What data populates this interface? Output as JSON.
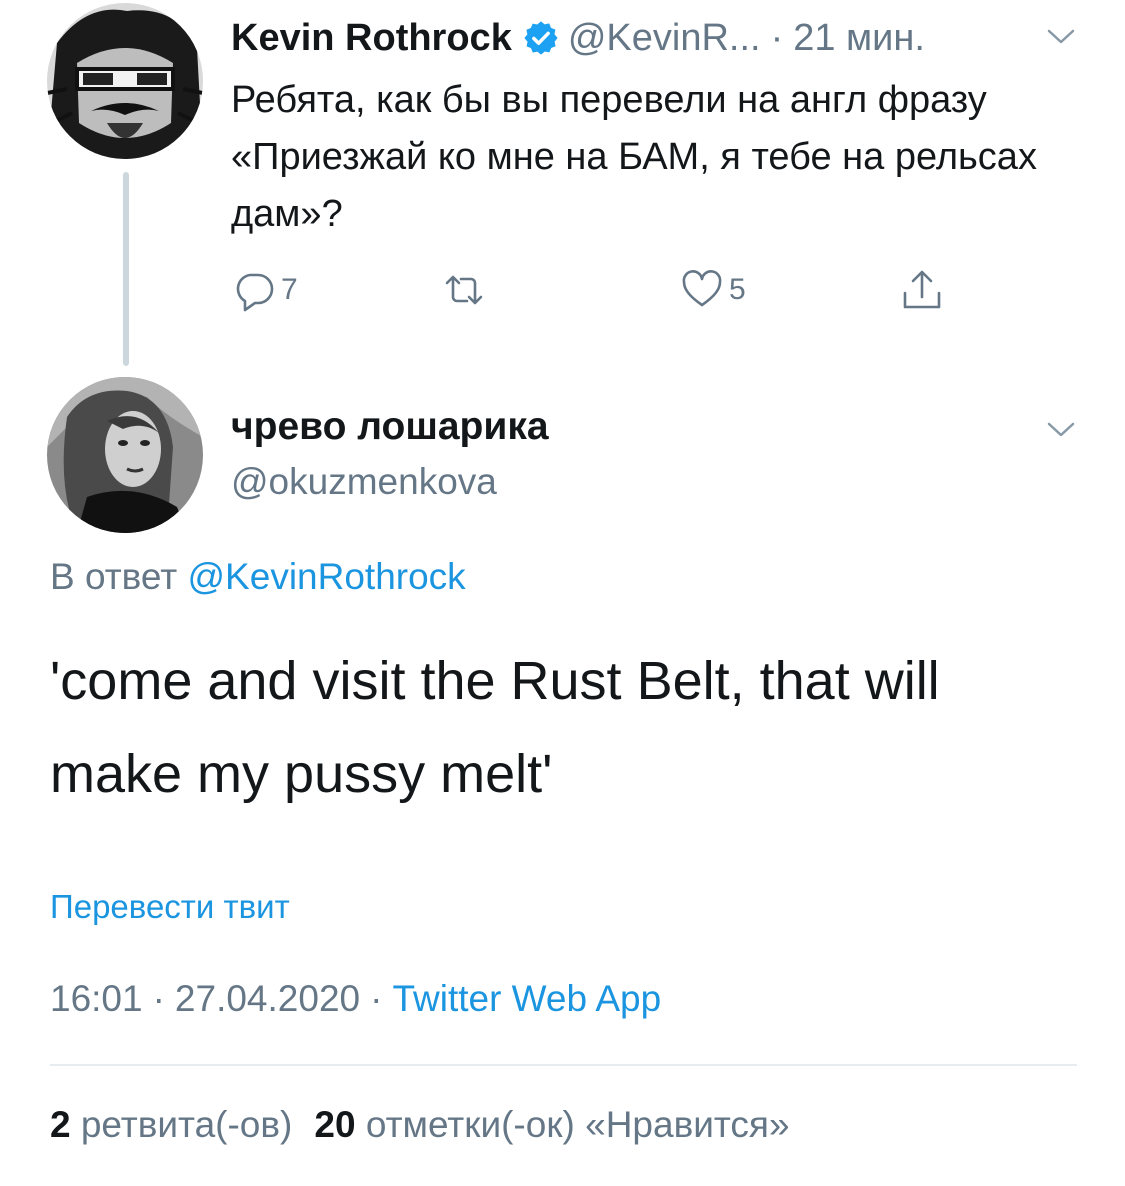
{
  "parent_tweet": {
    "author_name": "Kevin Rothrock",
    "verified_icon": "verified-badge-icon",
    "handle": "@KevinR...",
    "separator": "·",
    "time": "21 мин.",
    "text": "Ребята, как бы вы перевели на англ фразу «Приезжай ко мне на БАМ, я тебе на рельсах дам»?",
    "actions": {
      "reply_count": "7",
      "retweet_count": "",
      "like_count": "5"
    }
  },
  "reply_tweet": {
    "author_name": "чрево лошарика",
    "handle": "@okuzmenkova",
    "reply_to_prefix": "В ответ",
    "reply_to_mention": "@KevinRothrock",
    "text": "'come and visit the Rust Belt, that will make my pussy melt'",
    "translate_label": "Перевести твит",
    "time": "16:01",
    "date": "27.04.2020",
    "separator": "·",
    "source": "Twitter Web App",
    "stats": {
      "retweets_num": "2",
      "retweets_label": "ретвита(-ов)",
      "likes_num": "20",
      "likes_label": "отметки(-ок) «Нравится»"
    }
  },
  "colors": {
    "text_primary": "#14171a",
    "text_secondary": "#657786",
    "link_blue": "#1b95e0",
    "thread_line": "#ccd6dd",
    "divider": "#e6ecf0"
  }
}
